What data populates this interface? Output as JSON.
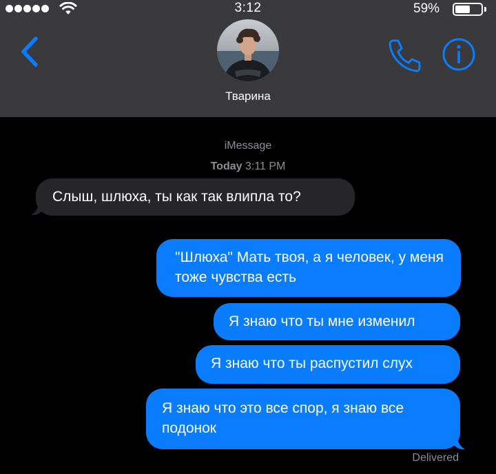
{
  "status_bar": {
    "time": "3:12",
    "battery_percent": "59%",
    "battery_level": 0.59
  },
  "header": {
    "contact_name": "Тварина",
    "accent_color": "#0a7cff"
  },
  "conversation": {
    "service": "iMessage",
    "timestamp_day": "Today",
    "timestamp_time": "3:11 PM",
    "messages": [
      {
        "direction": "incoming",
        "text": "Слыш, шлюха, ты как так влипла то?"
      },
      {
        "direction": "outgoing",
        "text": "\"Шлюха\" Мать твоя, а я человек, у меня тоже чувства есть"
      },
      {
        "direction": "outgoing",
        "text": "Я знаю что ты мне изменил"
      },
      {
        "direction": "outgoing",
        "text": "Я знаю что ты распустил слух"
      },
      {
        "direction": "outgoing",
        "text": "Я знаю что это все спор, я знаю все подонок"
      }
    ],
    "status": "Delivered"
  },
  "colors": {
    "background": "#000000",
    "header_background": "#3a3a3c",
    "incoming_bubble": "#262629",
    "outgoing_bubble": "#0a7cff",
    "secondary_text": "#8e8e93"
  },
  "icons": [
    "signal-dots-icon",
    "wifi-icon",
    "battery-icon",
    "back-chevron-icon",
    "phone-icon",
    "info-icon"
  ]
}
